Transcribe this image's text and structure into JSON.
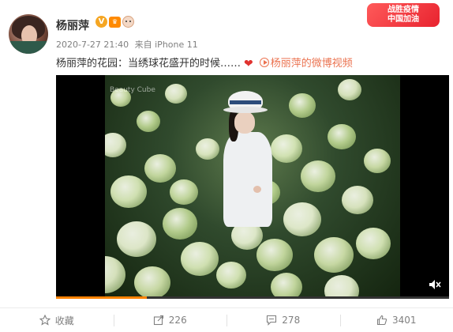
{
  "post": {
    "username": "杨丽萍",
    "verified_mark": "V",
    "meta": {
      "timestamp": "2020-7-27 21:40",
      "source_prefix": "来自",
      "source": "iPhone 11"
    },
    "campaign_badge": {
      "line1": "战胜疫情",
      "line2": "中国加油"
    },
    "content": {
      "text": "杨丽萍的花园：当绣球花盛开的时候……",
      "heart": "❤",
      "video_link_label": "杨丽萍的微博视频"
    },
    "video": {
      "watermark": "Beauty Cube",
      "progress": 0.23
    },
    "actions": [
      {
        "id": "favorite",
        "label": "收藏",
        "icon": "star-icon"
      },
      {
        "id": "repost",
        "label": "226",
        "icon": "repost-icon"
      },
      {
        "id": "comment",
        "label": "278",
        "icon": "comment-icon"
      },
      {
        "id": "like",
        "label": "3401",
        "icon": "thumbs-up-icon"
      }
    ]
  },
  "colors": {
    "link": "#eb7350",
    "muted": "#808080",
    "progress": "#ff8200"
  }
}
